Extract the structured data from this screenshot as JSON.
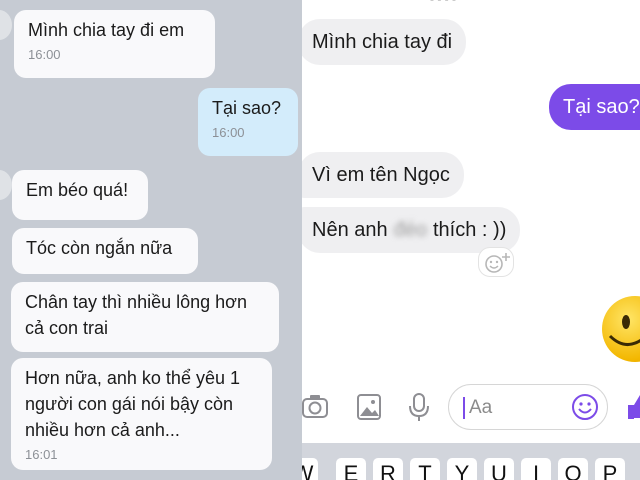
{
  "left_chat": {
    "messages": [
      {
        "text": "Mình chia tay đi em",
        "time": "16:00"
      },
      {
        "text": "Tại sao?",
        "time": "16:00"
      },
      {
        "text": "Em béo quá!"
      },
      {
        "text": "Tóc còn ngắn nữa"
      },
      {
        "text": "Chân tay thì nhiều lông hơn cả con trai"
      },
      {
        "text": "Hơn nữa, anh ko thể yêu 1 người con gái nói bậy còn nhiều hơn cả anh...",
        "time": "16:01"
      }
    ]
  },
  "right_chat": {
    "messages": [
      {
        "text": "Mình chia tay đi"
      },
      {
        "text": "Tại sao?"
      },
      {
        "text": "Vì em tên Ngọc"
      },
      {
        "text_before": "Nên anh",
        "text_blurred": "đéo",
        "text_after": "thích : ))"
      }
    ],
    "composer": {
      "placeholder": "Aa"
    },
    "keyboard_keys": [
      "W",
      "E",
      "R",
      "T",
      "Y",
      "U",
      "I",
      "O",
      "P"
    ]
  },
  "icons": [
    "camera-icon",
    "photo-icon",
    "microphone-icon",
    "emoji-icon",
    "thumbs-up-icon",
    "add-reaction-icon",
    "smiley-sticker"
  ]
}
